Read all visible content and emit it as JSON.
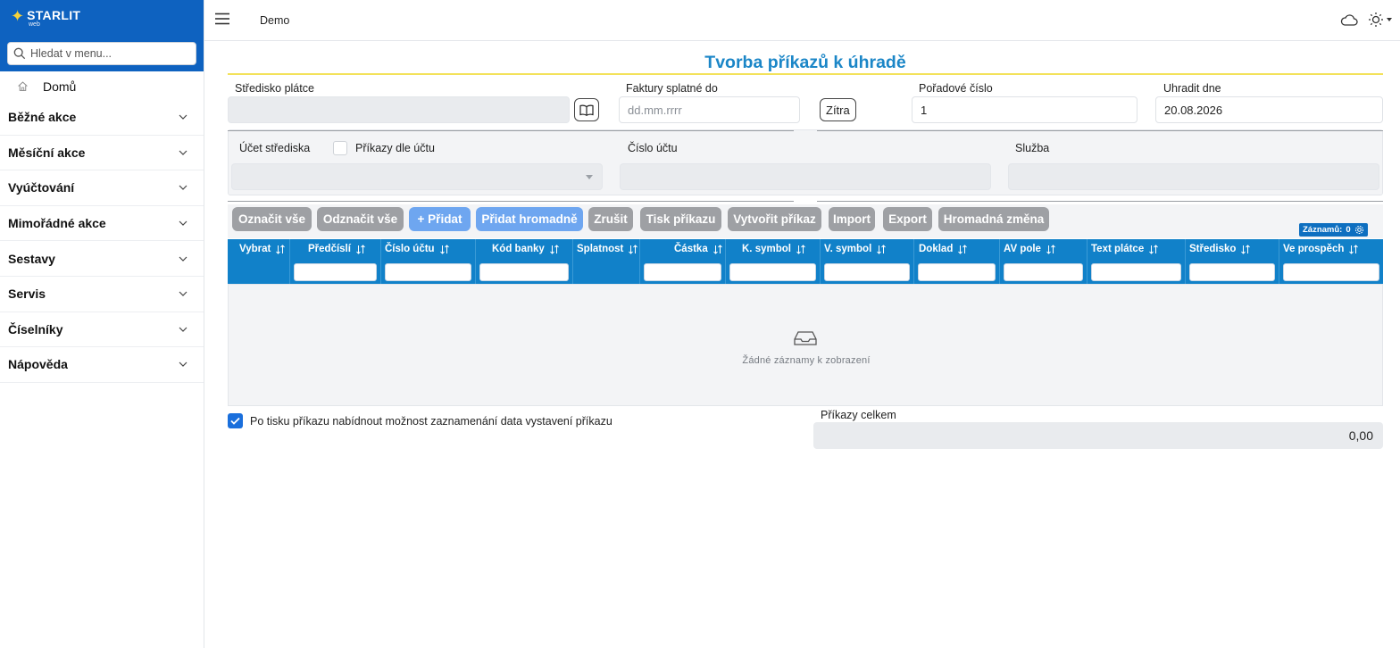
{
  "brand": {
    "name": "STARLIT",
    "sub": "web",
    "accent": "#0e62c0",
    "star_color": "#f6d23b"
  },
  "sidebar": {
    "search_placeholder": "Hledat v menu...",
    "home": "Domů",
    "items": [
      {
        "label": "Běžné akce"
      },
      {
        "label": "Měsíční akce"
      },
      {
        "label": "Vyúčtování"
      },
      {
        "label": "Mimořádné akce"
      },
      {
        "label": "Sestavy"
      },
      {
        "label": "Servis"
      },
      {
        "label": "Číselníky"
      },
      {
        "label": "Nápověda"
      }
    ]
  },
  "topbar": {
    "breadcrumb": "Demo",
    "icons": [
      "menu-icon",
      "cloud-icon",
      "sun-icon"
    ]
  },
  "page": {
    "title": "Tvorba příkazů k úhradě",
    "title_color": "#1b86c7",
    "fields": {
      "stredisko_label": "Středisko plátce",
      "stredisko_value": "",
      "faktury_label": "Faktury splatné do",
      "faktury_placeholder": "dd.mm.rrrr",
      "zitra_label": "Zítra",
      "poradove_label": "Pořadové číslo",
      "poradove_value": "1",
      "uhradit_label": "Uhradit dne",
      "uhradit_value": "20.08.2026"
    },
    "panel": {
      "ucet_label": "Účet střediska",
      "prikazy_dle_uctu": "Příkazy dle účtu",
      "cislo_uctu_label": "Číslo účtu",
      "sluzba_label": "Služba"
    },
    "toolbar": [
      {
        "label": "Označit vše",
        "style": "gray"
      },
      {
        "label": "Odznačit vše",
        "style": "gray"
      },
      {
        "label": "+ Přidat",
        "style": "blue"
      },
      {
        "label": "Přidat hromadně",
        "style": "blue"
      },
      {
        "label": "Zrušit",
        "style": "gray"
      },
      {
        "label": "Tisk příkazu",
        "style": "gray"
      },
      {
        "label": "Vytvořit příkaz",
        "style": "gray"
      },
      {
        "label": "Import",
        "style": "gray"
      },
      {
        "label": "Export",
        "style": "gray"
      },
      {
        "label": "Hromadná změna",
        "style": "gray"
      }
    ],
    "records_label": "Záznamů:",
    "records_count": "0",
    "table": {
      "header_color": "#1181c9",
      "columns": [
        "Vybrat",
        "Předčíslí",
        "Číslo účtu",
        "Kód banky",
        "Splatnost",
        "Částka",
        "K. symbol",
        "V. symbol",
        "Doklad",
        "AV pole",
        "Text plátce",
        "Středisko",
        "Ve prospěch"
      ],
      "empty_text": "Žádné záznamy k zobrazení"
    },
    "print_option": {
      "checked": true,
      "label": "Po tisku příkazu nabídnout možnost zaznamenání data vystavení příkazu"
    },
    "total": {
      "label": "Příkazy celkem",
      "value": "0,00"
    }
  }
}
